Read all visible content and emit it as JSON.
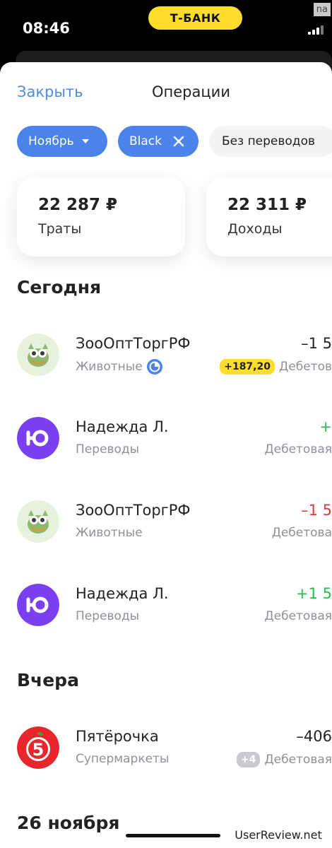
{
  "status_bar": {
    "time": "08:46",
    "bank_name": "Т-БАНК",
    "carrier": "na"
  },
  "header": {
    "close_label": "Закрыть",
    "title": "Операции"
  },
  "filters": {
    "month": "Ноябрь",
    "card": "Black",
    "transfers": "Без переводов"
  },
  "summary": {
    "spending": {
      "amount": "22 287 ₽",
      "label": "Траты"
    },
    "income": {
      "amount": "22 311 ₽",
      "label": "Доходы"
    }
  },
  "sections": {
    "today": "Сегодня",
    "yesterday": "Вчера",
    "nov26": "26 ноября"
  },
  "operations": [
    {
      "name": "ЗооОптТоргРФ",
      "category": "Животные",
      "amount": "–1 5",
      "cashback": "+187,20",
      "account": "Дебетов",
      "amount_color": "#222222"
    },
    {
      "name": "Надежда Л.",
      "category": "Переводы",
      "amount": "+",
      "account": "Дебетовая",
      "amount_color": "#2FB84B"
    },
    {
      "name": "ЗооОптТоргРФ",
      "category": "Животные",
      "amount": "–1 5",
      "account": "Дебетова",
      "amount_color": "#E0383E"
    },
    {
      "name": "Надежда Л.",
      "category": "Переводы",
      "amount": "+1 5",
      "account": "Дебетовая",
      "amount_color": "#2FB84B"
    },
    {
      "name": "Пятёрочка",
      "category": "Супермаркеты",
      "amount": "–406",
      "badge": "+4",
      "account": "Дебетовая",
      "amount_color": "#222222"
    }
  ],
  "watermark": "UserReview.net",
  "colors": {
    "accent": "#4A84EB",
    "link": "#4E8CE5",
    "brand_yellow": "#FFDD2D",
    "income_green": "#2FB84B",
    "expense_red": "#E0383E"
  }
}
